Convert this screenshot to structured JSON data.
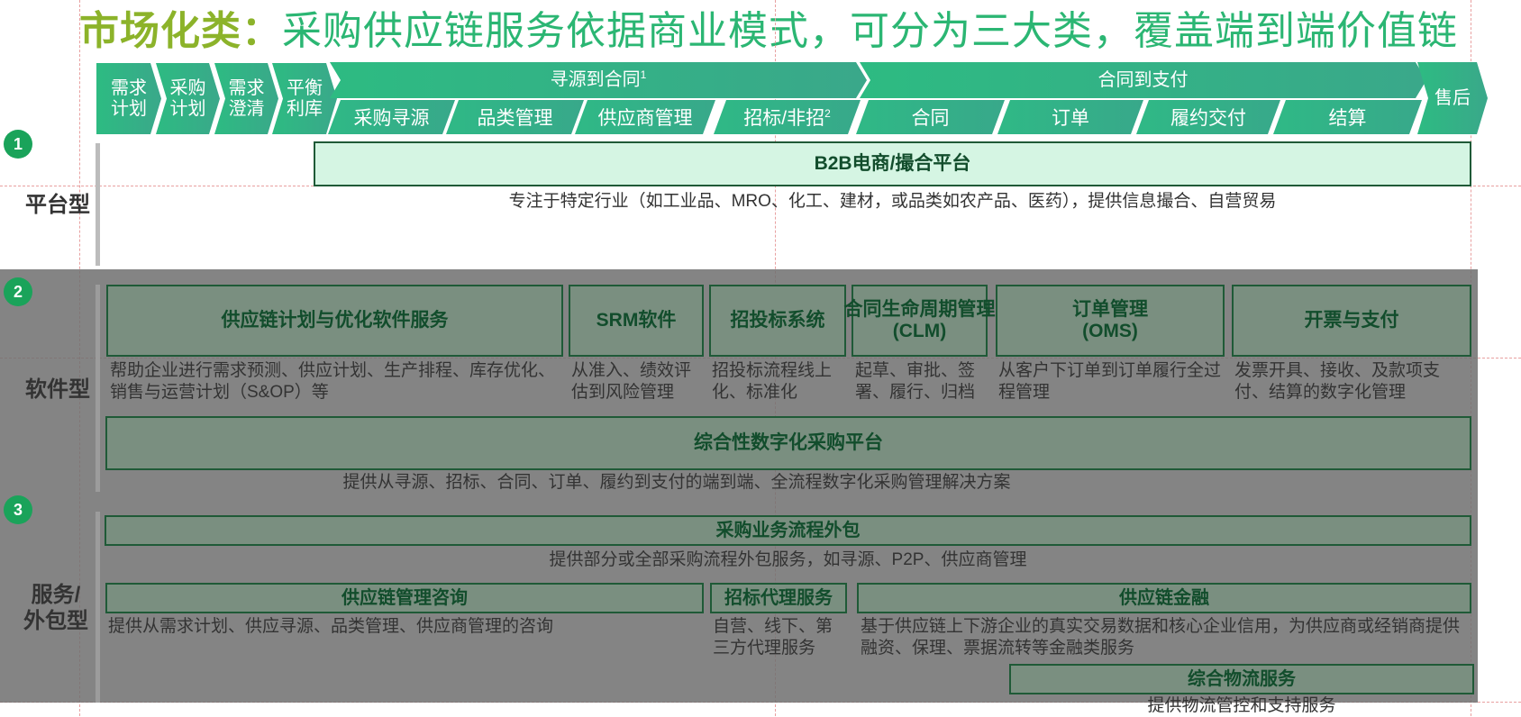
{
  "title": {
    "prefix": "市场化类：",
    "main": "采购供应链服务依据商业模式，可分为三大类，覆盖端到端价值链"
  },
  "process": {
    "simple": [
      {
        "label": "需求\n计划"
      },
      {
        "label": "采购\n计划"
      },
      {
        "label": "需求\n澄清"
      },
      {
        "label": "平衡\n利库"
      }
    ],
    "group1": {
      "label": "寻源到合同",
      "sup": "1"
    },
    "group2": {
      "label": "合同到支付"
    },
    "after_sales": "售后",
    "subs": [
      {
        "label": "采购寻源"
      },
      {
        "label": "品类管理"
      },
      {
        "label": "供应商管理"
      },
      {
        "label": "招标/非招",
        "sup": "2"
      },
      {
        "label": "合同"
      },
      {
        "label": "订单"
      },
      {
        "label": "履约交付"
      },
      {
        "label": "结算"
      }
    ]
  },
  "sections": {
    "platform": {
      "number": "1",
      "label": "平台型",
      "box": "B2B电商/撮合平台",
      "desc": "专注于特定行业（如工业品、MRO、化工、建材，或品类如农产品、医药），提供信息撮合、自营贸易"
    },
    "software": {
      "number": "2",
      "label": "软件型",
      "boxes": [
        {
          "title": "供应链计划与优化软件服务",
          "desc": "帮助企业进行需求预测、供应计划、生产排程、库存优化、销售与运营计划（S&OP）等"
        },
        {
          "title": "SRM软件",
          "desc": "从准入、绩效评估到风险管理"
        },
        {
          "title": "招投标系统",
          "desc": "招投标流程线上化、标准化"
        },
        {
          "title": "合同生命周期管理\n(CLM)",
          "desc": "起草、审批、签署、履行、归档"
        },
        {
          "title": "订单管理\n(OMS)",
          "desc": "从客户下订单到订单履行全过程管理"
        },
        {
          "title": "开票与支付",
          "desc": "发票开具、接收、及款项支付、结算的数字化管理"
        }
      ],
      "platform_box": "综合性数字化采购平台",
      "platform_desc": "提供从寻源、招标、合同、订单、履约到支付的端到端、全流程数字化采购管理解决方案"
    },
    "service": {
      "number": "3",
      "label": "服务/\n外包型",
      "outsourcing": {
        "title": "采购业务流程外包",
        "desc": "提供部分或全部采购流程外包服务，如寻源、P2P、供应商管理"
      },
      "consulting": {
        "title": "供应链管理咨询",
        "desc": "提供从需求计划、供应寻源、品类管理、供应商管理的咨询"
      },
      "agency": {
        "title": "招标代理服务",
        "desc": "自营、线下、第三方代理服务"
      },
      "finance": {
        "title": "供应链金融",
        "desc": "基于供应链上下游企业的真实交易数据和核心企业信用，为供应商或经销商提供融资、保理、票据流转等金融类服务"
      },
      "logistics": {
        "title": "综合物流服务",
        "desc": "提供物流管控和支持服务"
      }
    }
  }
}
